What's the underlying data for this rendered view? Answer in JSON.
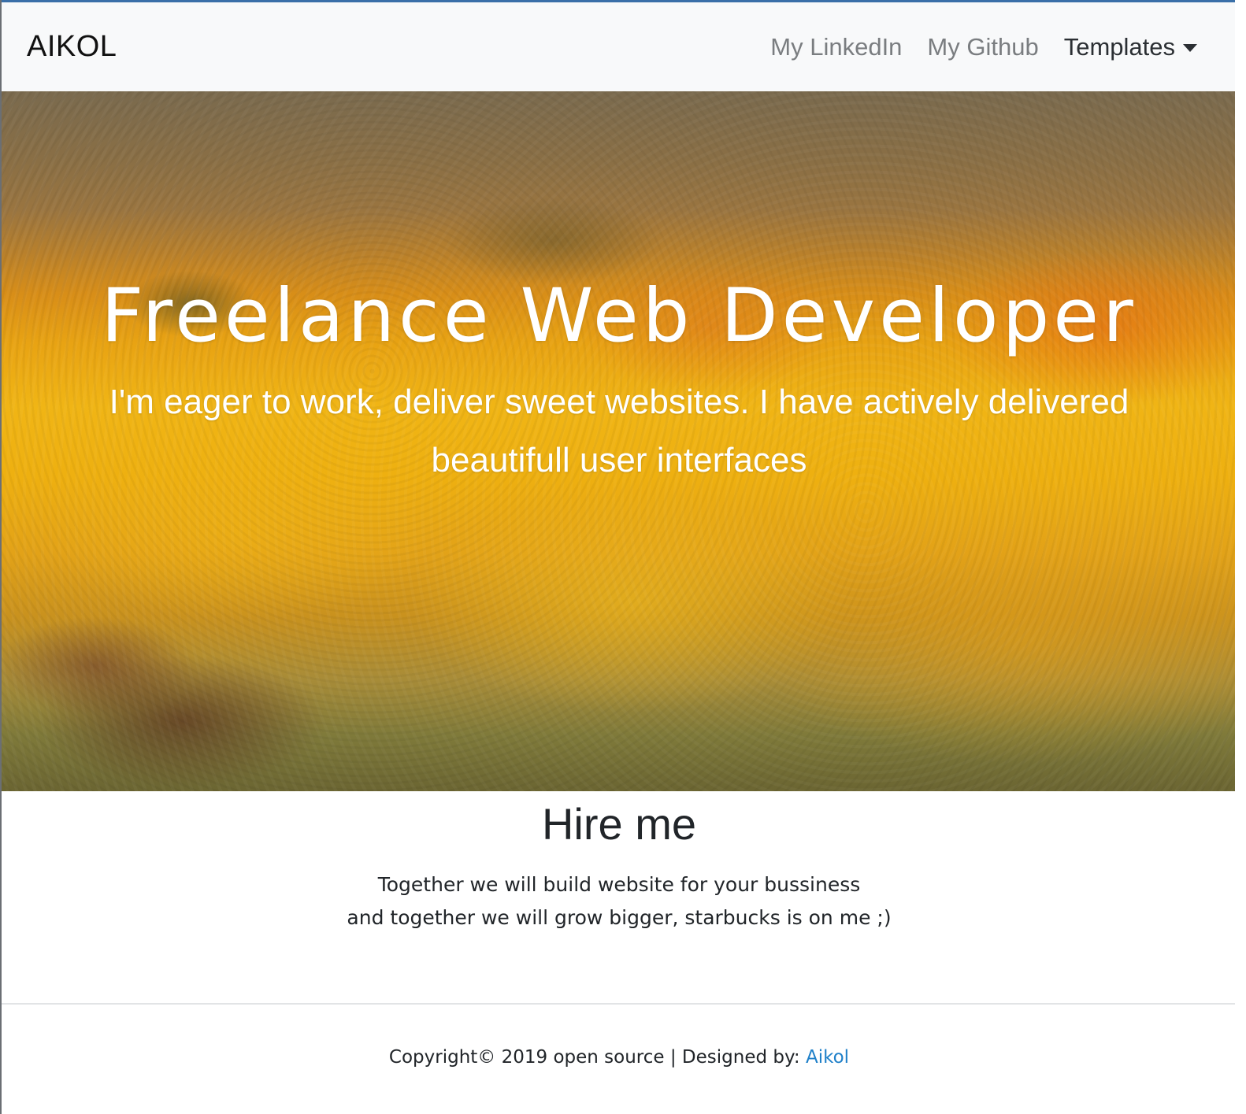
{
  "navbar": {
    "brand": "AIKOL",
    "links": [
      {
        "label": "My LinkedIn"
      },
      {
        "label": "My Github"
      }
    ],
    "dropdown_label": "Templates"
  },
  "hero": {
    "title": "Freelance Web Developer",
    "subtitle_line1": "I'm eager to work, deliver sweet websites. I have actively delivered",
    "subtitle_line2": "beautifull user interfaces"
  },
  "hire": {
    "title": "Hire me",
    "line1": "Together we will build website for your bussiness",
    "line2": "and together we will grow bigger, starbucks is on me ;)"
  },
  "footer": {
    "text": "Copyright© 2019 open source | Designed by: ",
    "designer_link": "Aikol"
  },
  "colors": {
    "navbar_bg": "#f8f9fa",
    "link_muted": "#7a7d80",
    "footer_link": "#1f80c9",
    "text_dark": "#212529"
  }
}
